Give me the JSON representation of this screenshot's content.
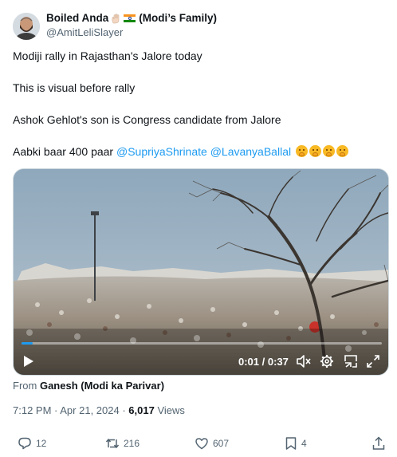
{
  "author": {
    "display_name": "Boiled Anda",
    "display_suffix": "(Modi’s Family)",
    "handle": "@AmitLeliSlayer"
  },
  "tweet": {
    "lines": [
      "Modiji rally in Rajasthan's Jalore today",
      "This is visual before rally",
      "Ashok Gehlot's son is Congress candidate from Jalore"
    ],
    "last_line_prefix": "Aabki baar 400 paar",
    "mentions": [
      "@SupriyaShrinate",
      "@LavanyaBallal"
    ],
    "trailing_emoji_name": "face-with-hand-over-mouth",
    "trailing_emoji_count": 4
  },
  "video": {
    "current_time": "0:01",
    "separator": " / ",
    "duration": "0:37",
    "progress_fraction": 0.03,
    "controls": [
      "play-icon",
      "mute-icon",
      "settings-icon",
      "minimize-icon",
      "fullscreen-icon"
    ]
  },
  "source": {
    "prefix": "From",
    "name": "Ganesh (Modi ka Parivar)"
  },
  "meta": {
    "time": "7:12 PM",
    "separator": " · ",
    "date": "Apr 21, 2024",
    "views_count": "6,017",
    "views_label": "Views"
  },
  "actions": {
    "replies": "12",
    "reposts": "216",
    "likes": "607",
    "bookmarks": "4"
  },
  "colors": {
    "accent": "#1d9bf0",
    "secondary_text": "#536471",
    "primary_text": "#0f1419"
  }
}
